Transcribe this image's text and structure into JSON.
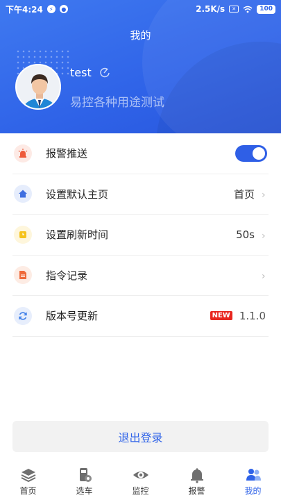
{
  "status_bar": {
    "time": "下午4:24",
    "network_speed": "2.5K/s",
    "battery": "100"
  },
  "header": {
    "title": "我的",
    "username": "test",
    "subtitle": "易控各种用途测试"
  },
  "settings": {
    "alarm_push": {
      "label": "报警推送",
      "enabled": true
    },
    "default_home": {
      "label": "设置默认主页",
      "value": "首页"
    },
    "refresh_time": {
      "label": "设置刷新时间",
      "value": "50s"
    },
    "command_log": {
      "label": "指令记录"
    },
    "version_update": {
      "label": "版本号更新",
      "badge": "NEW",
      "value": "1.1.0"
    }
  },
  "logout_label": "退出登录",
  "tabs": [
    {
      "label": "首页",
      "icon": "layers-icon",
      "active": false
    },
    {
      "label": "选车",
      "icon": "car-select-icon",
      "active": false
    },
    {
      "label": "监控",
      "icon": "eye-icon",
      "active": false
    },
    {
      "label": "报警",
      "icon": "bell-icon",
      "active": false
    },
    {
      "label": "我的",
      "icon": "users-icon",
      "active": true
    }
  ],
  "colors": {
    "primary": "#2f63e8",
    "alarm_icon": "#ee5b3b",
    "home_icon": "#3f6fe0",
    "refresh_icon": "#f5c21b",
    "command_icon": "#ef6a3a",
    "version_icon": "#3f7fe8",
    "badge": "#e8261f"
  }
}
